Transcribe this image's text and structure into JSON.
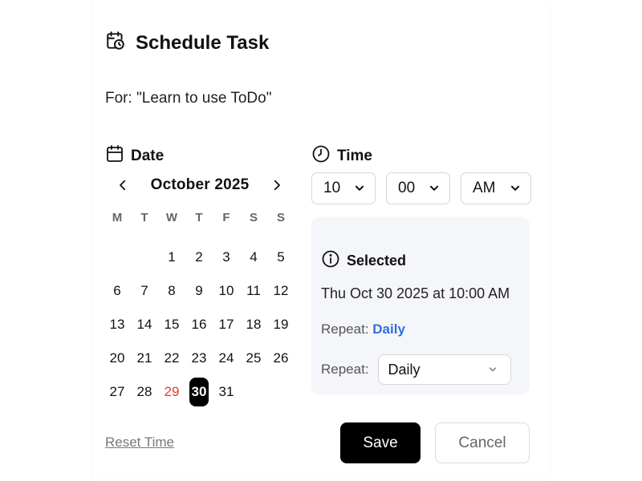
{
  "dialog": {
    "title": "Schedule Task",
    "for_text": "For: \"Learn to use ToDo\""
  },
  "date": {
    "label": "Date",
    "month_label": "October 2025",
    "weekdays": [
      "M",
      "T",
      "W",
      "T",
      "F",
      "S",
      "S"
    ],
    "weeks": [
      [
        "",
        "",
        "1",
        "2",
        "3",
        "4",
        "5"
      ],
      [
        "6",
        "7",
        "8",
        "9",
        "10",
        "11",
        "12"
      ],
      [
        "13",
        "14",
        "15",
        "16",
        "17",
        "18",
        "19"
      ],
      [
        "20",
        "21",
        "22",
        "23",
        "24",
        "25",
        "26"
      ],
      [
        "27",
        "28",
        "29",
        "30",
        "31",
        "",
        ""
      ]
    ],
    "today": "29",
    "selected": "30"
  },
  "time": {
    "label": "Time",
    "hour": "10",
    "minute": "00",
    "ampm": "AM"
  },
  "selected_panel": {
    "heading": "Selected",
    "datetime": "Thu Oct 30 2025 at 10:00 AM",
    "repeat_prefix": "Repeat:",
    "repeat_value": "Daily",
    "repeat_label": "Repeat:",
    "repeat_select_value": "Daily"
  },
  "actions": {
    "reset_label": "Reset Time",
    "save_label": "Save",
    "cancel_label": "Cancel"
  },
  "colors": {
    "today": "#e53935",
    "selected_bg": "#000000",
    "repeat_accent": "#2f6fe0",
    "panel_bg": "#f4f6fa"
  }
}
